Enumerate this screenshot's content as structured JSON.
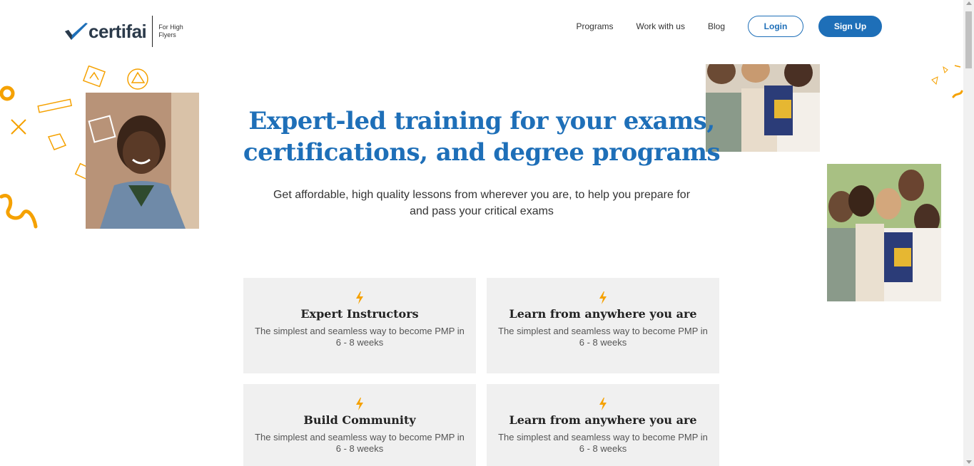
{
  "brand": {
    "name": "certifai",
    "tagline": "For High Flyers"
  },
  "nav": {
    "links": [
      "Programs",
      "Work with us",
      "Blog"
    ],
    "login_label": "Login",
    "signup_label": "Sign Up"
  },
  "hero": {
    "title_line1": "Expert-led training for your exams,",
    "title_line2": "certifications, and degree programs",
    "subtitle": "Get affordable, high quality lessons from wherever you are, to help you prepare for and pass your critical exams"
  },
  "features": [
    {
      "title": "Expert Instructors",
      "description": "The simplest and seamless way to become PMP in 6 - 8 weeks"
    },
    {
      "title": "Learn from anywhere you are",
      "description": "The simplest and seamless way to become PMP in 6 - 8 weeks"
    },
    {
      "title": "Build Community",
      "description": "The simplest and seamless way to become PMP in 6 - 8 weeks"
    },
    {
      "title": "Learn from anywhere you are",
      "description": "The simplest and seamless way to become PMP in 6 - 8 weeks"
    }
  ],
  "colors": {
    "brand_blue": "#1e6fb8",
    "accent_orange": "#f5a100",
    "card_bg": "#f0f0f0"
  },
  "icons": {
    "feature": "lightning-bolt-icon",
    "logo": "checkmark-logo-icon"
  }
}
